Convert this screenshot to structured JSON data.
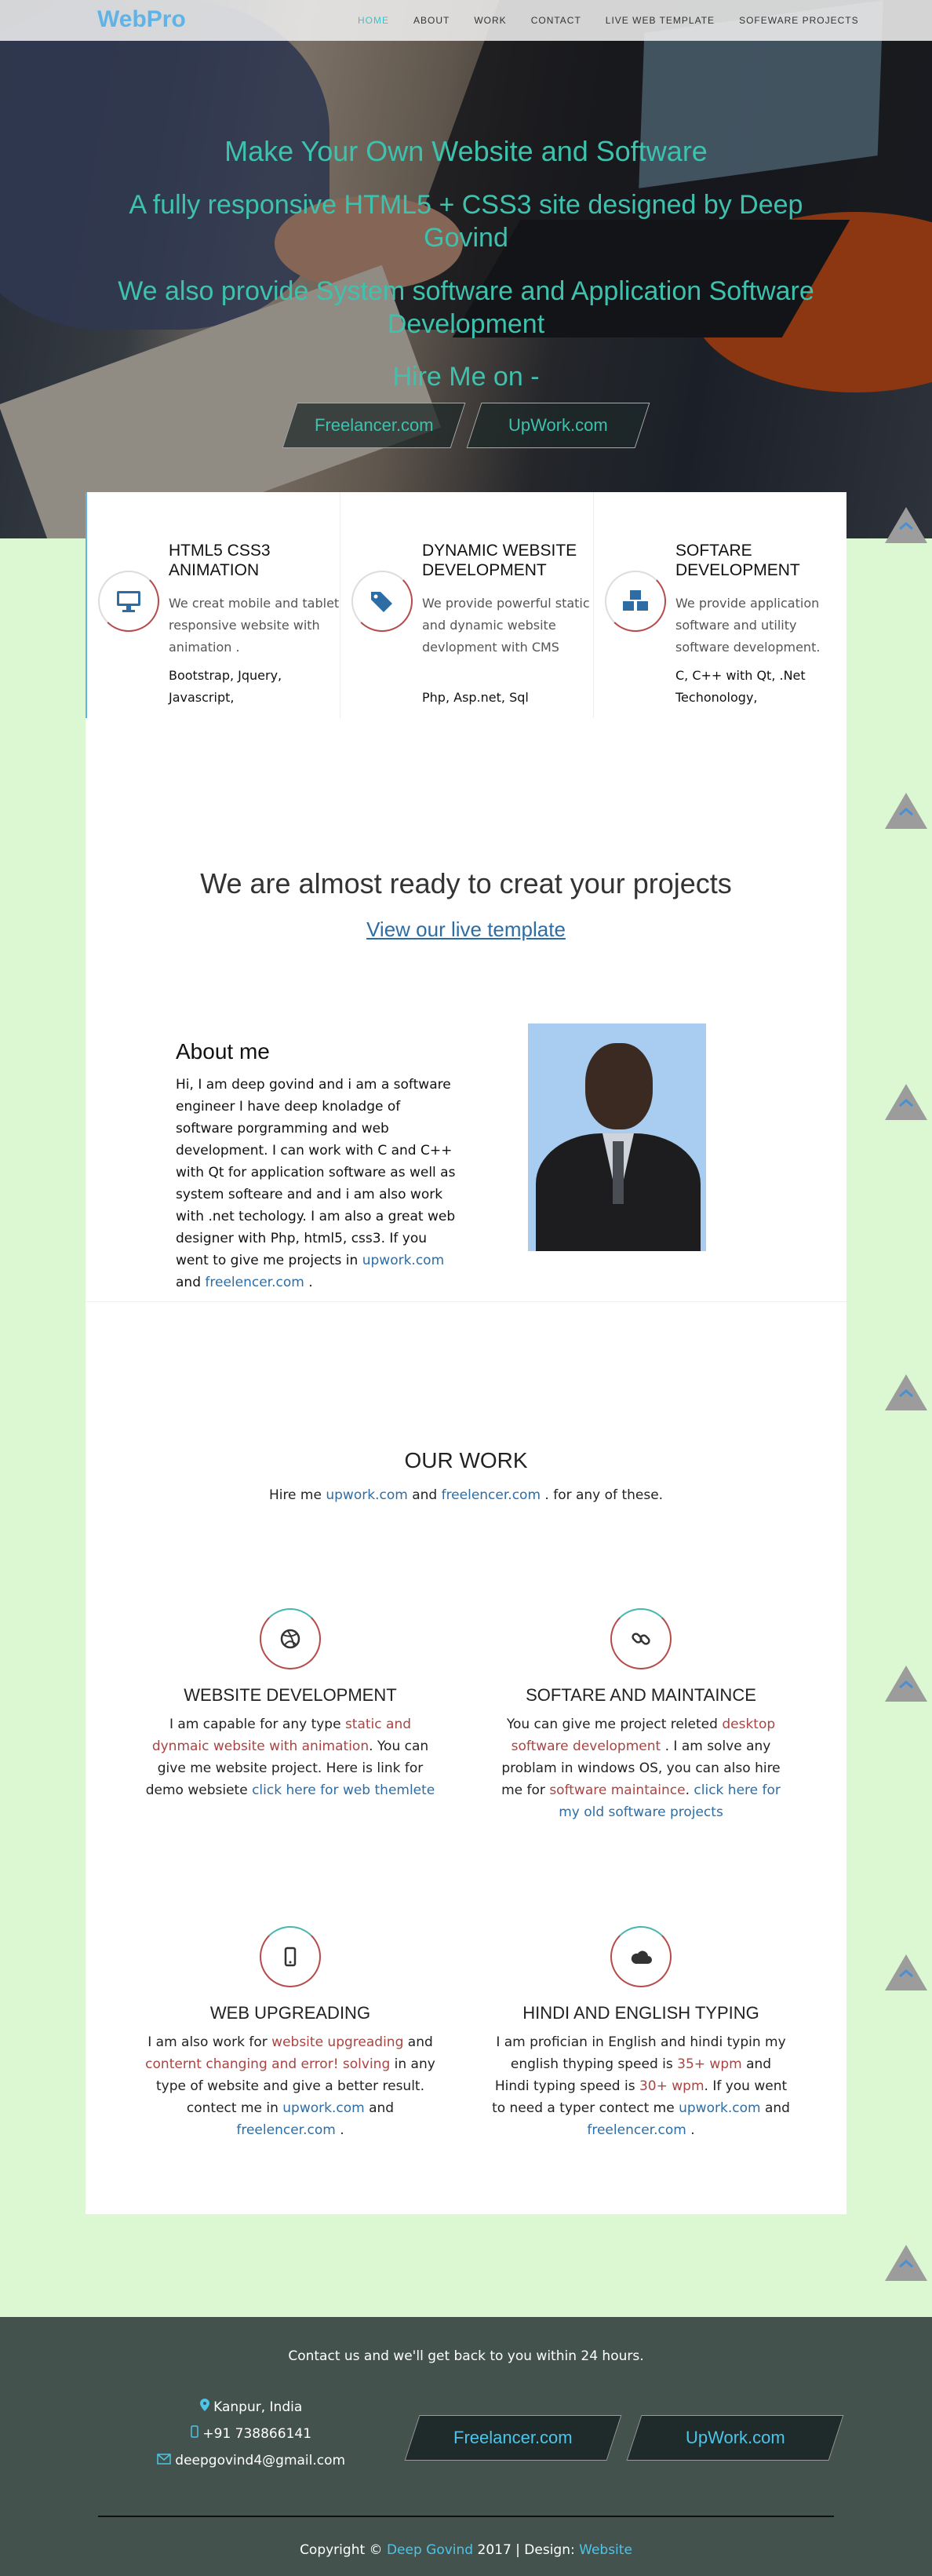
{
  "nav": {
    "logo": "WebPro",
    "items": [
      "HOME",
      "ABOUT",
      "WORK",
      "CONTACT",
      "LIVE WEB TEMPLATE",
      "SOFEWARE PROJECTS"
    ],
    "active_color": "#3ec1c9"
  },
  "hero": {
    "line1": "Make Your Own Website and Software",
    "line2": "A fully responsive HTML5 + CSS3 site designed by Deep Govind",
    "line3": "We also provide System software and Application Software Development",
    "line4": "Hire Me on -",
    "btn_freelancer": "Freelancer.com",
    "btn_upwork": "UpWork.com",
    "text_color": "#3ec1ad"
  },
  "services": [
    {
      "title": "HTML5 CSS3 ANIMATION",
      "desc": "We creat mobile and tablet responsive website with animation .",
      "tech": "Bootstrap, Jquery, Javascript,",
      "icon": "monitor-icon"
    },
    {
      "title": "DYNAMIC WEBSITE DEVELOPMENT",
      "desc": "We provide powerful static and dynamic website devlopment with CMS",
      "tech": "Php, Asp.net, Sql",
      "icon": "tags-icon"
    },
    {
      "title": "SOFTARE DEVELOPMENT",
      "desc": "We provide application software and utility software development.",
      "tech": "C, C++ with Qt, .Net Techonology,",
      "icon": "cubes-icon"
    }
  ],
  "ready": {
    "heading": "We are almost ready to creat your projects",
    "link": "View our live template"
  },
  "about": {
    "heading": "About me",
    "text": "Hi, I am deep govind and i am a software engineer I have deep knoladge of software porgramming and web development. I can work with C and C++ with Qt for application software as well as system softeare and and i am also work with .net techology. I am also a great web designer with Php, html5, css3. If you went to give me projects in",
    "link1": "upwork.com",
    "and": "and",
    "link2": "freelencer.com",
    "end": "."
  },
  "work": {
    "heading": "OUR WORK",
    "sub_pre": "Hire me",
    "sub_link1": "upwork.com",
    "sub_and": "and",
    "sub_link2": "freelencer.com",
    "sub_post": ". for any of these.",
    "cards": [
      {
        "title": "WEBSITE DEVELOPMENT",
        "icon": "dribbble-icon",
        "t1": "I am capable for any type",
        "r1": "static and dynmaic website with animation",
        "t2": ". You can give me website project. Here is link for demo websiete",
        "l1": "click here for web themlete"
      },
      {
        "title": "SOFTARE AND MAINTAINCE",
        "icon": "link-icon",
        "t1": "You can give me project releted",
        "r1": "desktop software development",
        "t2": ". I am solve any problam in windows OS, you can also hire me for",
        "r2": "software maintaince",
        "t3": ".",
        "l1": "click here for my old software projects"
      },
      {
        "title": "WEB UPGREADING",
        "icon": "mobile-icon",
        "t1": "I am also work for",
        "r1": "website upgreading",
        "t2": "and",
        "r2": "conternt changing and error! solving",
        "t3": "in any type of website and give a better result. contect me in",
        "l1": "upwork.com",
        "t4": "and",
        "l2": "freelencer.com",
        "t5": "."
      },
      {
        "title": "HINDI AND ENGLISH TYPING",
        "icon": "cloud-icon",
        "t1": "I am profician in English and hindi typin my english thyping speed is",
        "r1": "35+ wpm",
        "t2": "and Hindi typing speed is",
        "r2": "30+ wpm",
        "t3": ". If you went to need a typer contect me",
        "l1": "upwork.com",
        "t4": "and",
        "l2": "freelencer.com",
        "t5": "."
      }
    ]
  },
  "footer": {
    "contact": "Contact us and we'll get back to you within 24 hours.",
    "location": "Kanpur, India",
    "phone": "+91 738866141",
    "email": "deepgovind4@gmail.com",
    "btn_freelancer": "Freelancer.com",
    "btn_upwork": "UpWork.com",
    "copy_pre": "Copyright ©",
    "copy_name": "Deep Govind",
    "copy_mid": "2017 | Design:",
    "copy_link": "Website"
  }
}
